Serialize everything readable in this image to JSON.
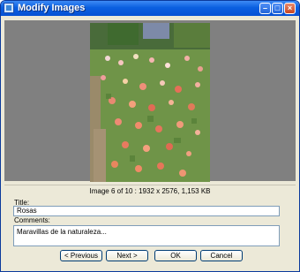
{
  "window": {
    "title": "Modify Images"
  },
  "image": {
    "alt": "Rosas"
  },
  "info": "Image 6 of 10 : 1932 x 2576, 1,153 KB",
  "form": {
    "title_label": "Title:",
    "title_value": "Rosas",
    "comments_label": "Comments:",
    "comments_value": "Maravillas de la naturaleza..."
  },
  "buttons": {
    "previous": "< Previous",
    "next": "Next >",
    "ok": "OK",
    "cancel": "Cancel"
  },
  "colors": {
    "title_bar": "#0a5fe0",
    "dialog_bg": "#ece9d8",
    "preview_bg": "#808080"
  }
}
